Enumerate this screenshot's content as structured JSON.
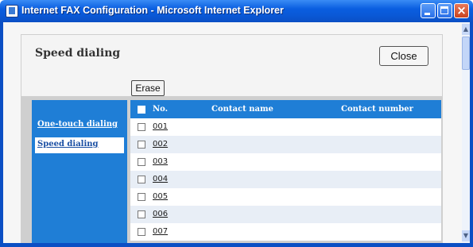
{
  "window": {
    "title": "Internet FAX Configuration - Microsoft Internet Explorer",
    "icon": "ie-page-icon"
  },
  "header": {
    "title": "Speed dialing",
    "close_label": "Close"
  },
  "toolbar": {
    "erase_label": "Erase"
  },
  "sidebar": {
    "items": [
      {
        "label": "One-touch dialing",
        "active": false
      },
      {
        "label": "Speed dialing",
        "active": true
      }
    ]
  },
  "table": {
    "columns": [
      "No.",
      "Contact name",
      "Contact number"
    ],
    "rows": [
      {
        "no": "001",
        "name": "",
        "number": ""
      },
      {
        "no": "002",
        "name": "",
        "number": ""
      },
      {
        "no": "003",
        "name": "",
        "number": ""
      },
      {
        "no": "004",
        "name": "",
        "number": ""
      },
      {
        "no": "005",
        "name": "",
        "number": ""
      },
      {
        "no": "006",
        "name": "",
        "number": ""
      },
      {
        "no": "007",
        "name": "",
        "number": ""
      }
    ]
  },
  "colors": {
    "titlebar": "#0a5ee0",
    "accent_blue": "#1f7ed6",
    "row_alt": "#e8eef6",
    "panel_gray": "#cfcfcf"
  }
}
